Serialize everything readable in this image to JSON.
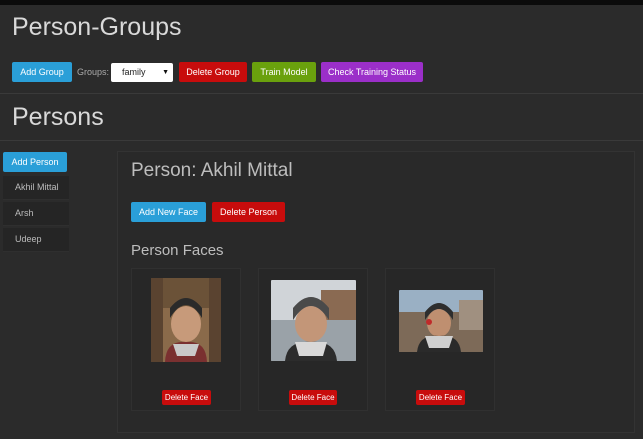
{
  "person_groups": {
    "title": "Person-Groups",
    "add_group_label": "Add Group",
    "groups_label": "Groups:",
    "selected_group": "family",
    "delete_group_label": "Delete Group",
    "train_model_label": "Train Model",
    "check_status_label": "Check Training Status"
  },
  "persons": {
    "title": "Persons",
    "add_person_label": "Add Person",
    "items": [
      "Akhil Mittal",
      "Arsh",
      "Udeep"
    ]
  },
  "detail": {
    "heading": "Person: Akhil Mittal",
    "add_face_label": "Add New Face",
    "delete_person_label": "Delete Person",
    "faces_heading": "Person Faces",
    "delete_face_label": "Delete Face"
  },
  "colors": {
    "blue": "#2a9fd8",
    "red": "#c80c0c",
    "green": "#6aa10d",
    "purple": "#9b2fc9",
    "background": "#2b2b2b"
  }
}
